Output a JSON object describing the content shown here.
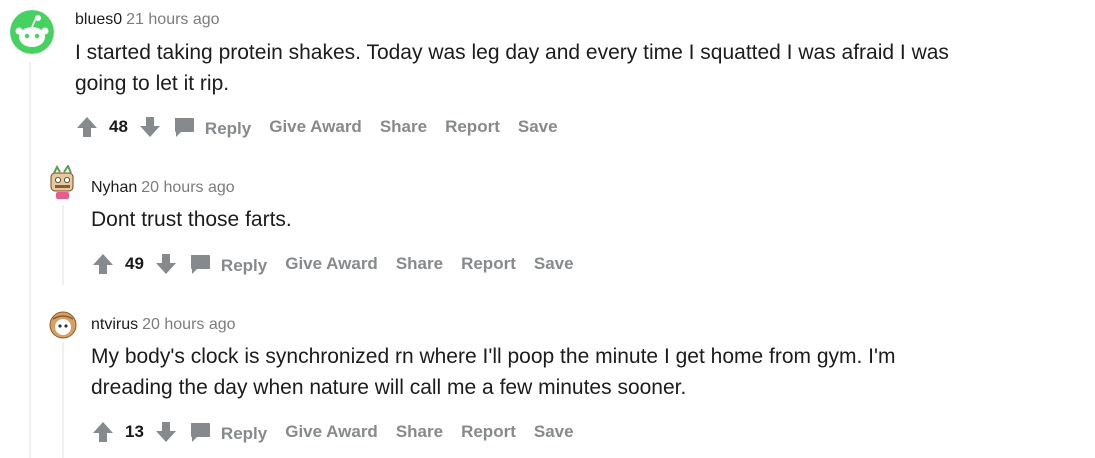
{
  "comments": [
    {
      "author": "blues0",
      "time": "21 hours ago",
      "lines": [
        "I started taking protein shakes. Today was leg day and every time I squatted I was afraid I was",
        "going to let it rip."
      ],
      "score": "48",
      "actions": {
        "reply": "Reply",
        "give_award": "Give Award",
        "share": "Share",
        "report": "Report",
        "save": "Save"
      }
    },
    {
      "author": "Nyhan",
      "time": "20 hours ago",
      "lines": [
        "Dont trust those farts."
      ],
      "score": "49",
      "actions": {
        "reply": "Reply",
        "give_award": "Give Award",
        "share": "Share",
        "report": "Report",
        "save": "Save"
      }
    },
    {
      "author": "ntvirus",
      "time": "20 hours ago",
      "lines": [
        "My body's clock is synchronized rn where I'll poop the minute I get home from gym. I'm",
        "dreading the day when nature will call me a few minutes sooner."
      ],
      "score": "13",
      "actions": {
        "reply": "Reply",
        "give_award": "Give Award",
        "share": "Share",
        "report": "Report",
        "save": "Save"
      }
    }
  ],
  "colors": {
    "action_gray": "#878a8c",
    "thread_line": "#edeff1",
    "avatar_green": "#46d160"
  }
}
